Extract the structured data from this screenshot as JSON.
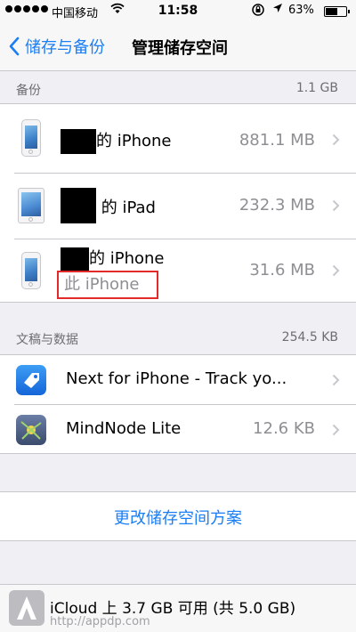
{
  "status_bar": {
    "carrier": "中国移动",
    "time": "11:58",
    "battery": "63%",
    "battery_level": 0.63
  },
  "nav": {
    "back_label": "储存与备份",
    "title": "管理储存空间"
  },
  "backups": {
    "header": "备份",
    "total": "1.1 GB",
    "devices": [
      {
        "name": "的 iPhone",
        "size": "881.1 MB",
        "icon": "iphone-icon"
      },
      {
        "name": "的 iPad",
        "size": "232.3 MB",
        "icon": "ipad-icon"
      },
      {
        "name": "的 iPhone",
        "subtitle": "此 iPhone",
        "size": "31.6 MB",
        "icon": "iphone-icon"
      }
    ]
  },
  "documents": {
    "header": "文稿与数据",
    "total": "254.5 KB",
    "apps": [
      {
        "name": "Next for iPhone - Track yo...",
        "size": "",
        "icon": "next-app-icon"
      },
      {
        "name": "MindNode Lite",
        "size": "12.6 KB",
        "icon": "mindnode-app-icon"
      }
    ]
  },
  "change_plan_label": "更改储存空间方案",
  "footer": {
    "storage_text": "iCloud 上 3.7 GB 可用 (共 5.0 GB)",
    "watermark_url": "http://appdp.com"
  },
  "colors": {
    "accent": "#1a7ef5",
    "highlight_border": "#e32a2a",
    "background": "#efeff4"
  }
}
